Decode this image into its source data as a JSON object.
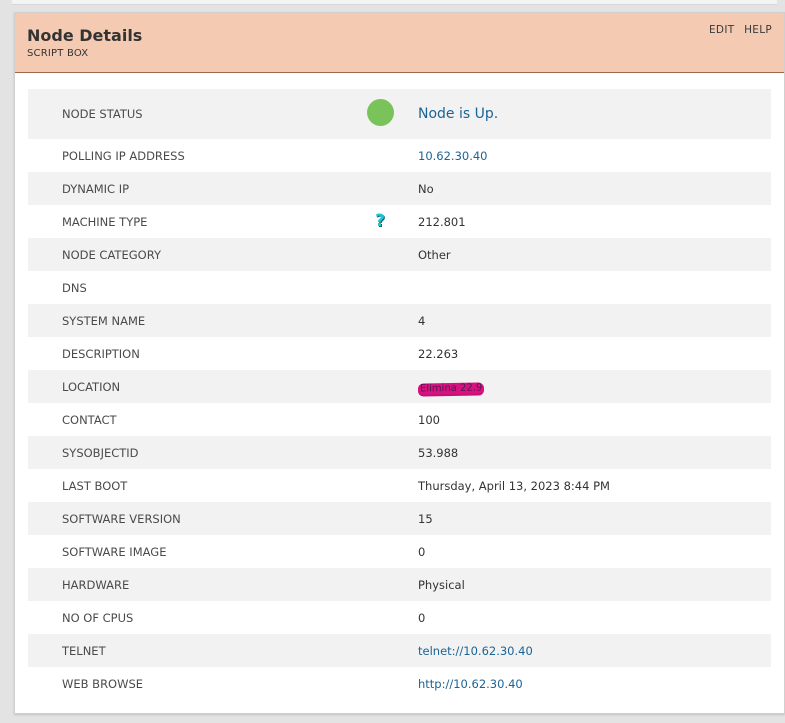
{
  "header": {
    "title": "Node Details",
    "subtitle": "SCRIPT BOX",
    "edit_label": "EDIT",
    "help_label": "HELP"
  },
  "colors": {
    "header_bg": "#f4cbb2",
    "status_up": "#7ac35a",
    "link": "#1a6496"
  },
  "rows": [
    {
      "label": "NODE STATUS",
      "value": "Node is Up.",
      "icon": "status-up-circle-icon"
    },
    {
      "label": "POLLING IP ADDRESS",
      "value": "10.62.30.40"
    },
    {
      "label": "DYNAMIC IP",
      "value": "No"
    },
    {
      "label": "MACHINE TYPE",
      "value": "212.801",
      "icon": "question-mark-icon"
    },
    {
      "label": "NODE CATEGORY",
      "value": "Other"
    },
    {
      "label": "DNS",
      "value": ""
    },
    {
      "label": "SYSTEM NAME",
      "value": "4"
    },
    {
      "label": "DESCRIPTION",
      "value": "22.263"
    },
    {
      "label": "LOCATION",
      "value": "Elimina 22.9"
    },
    {
      "label": "CONTACT",
      "value": "100"
    },
    {
      "label": "SYSOBJECTID",
      "value": "53.988"
    },
    {
      "label": "LAST BOOT",
      "value": "Thursday, April 13, 2023 8:44 PM"
    },
    {
      "label": "SOFTWARE VERSION",
      "value": "15"
    },
    {
      "label": "SOFTWARE IMAGE",
      "value": "0"
    },
    {
      "label": "HARDWARE",
      "value": "Physical"
    },
    {
      "label": "NO OF CPUS",
      "value": "0"
    },
    {
      "label": "TELNET",
      "value": "telnet://10.62.30.40"
    },
    {
      "label": "WEB BROWSE",
      "value": "http://10.62.30.40"
    }
  ]
}
